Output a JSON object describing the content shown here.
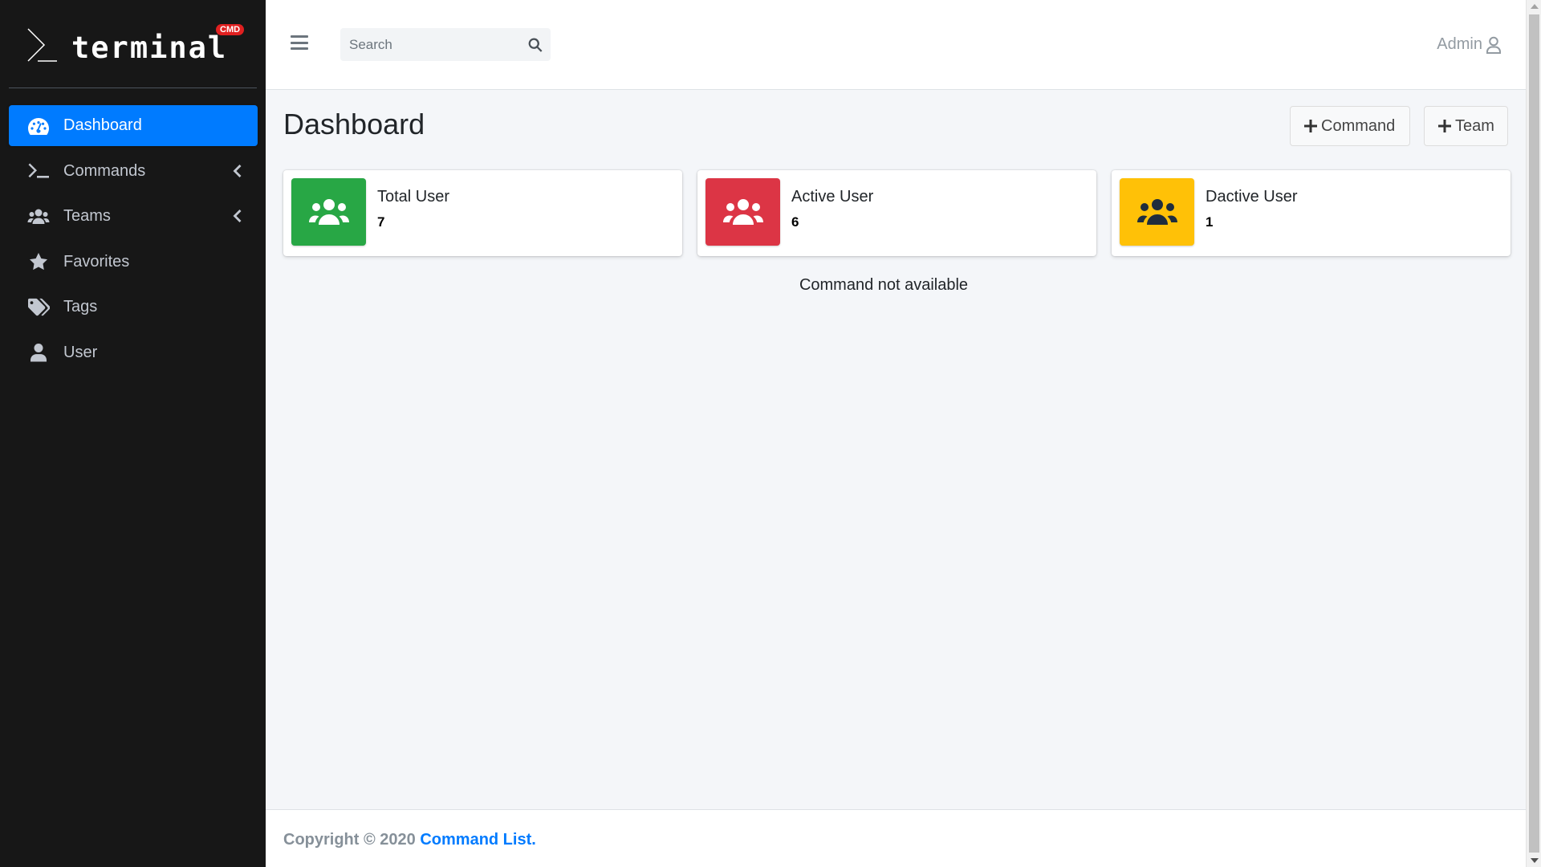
{
  "brand": {
    "name": "terminal",
    "badge": "CMD"
  },
  "sidebar": {
    "items": [
      {
        "label": "Dashboard",
        "icon": "tachometer-icon",
        "active": true
      },
      {
        "label": "Commands",
        "icon": "terminal-icon",
        "has_submenu": true
      },
      {
        "label": "Teams",
        "icon": "users-icon",
        "has_submenu": true
      },
      {
        "label": "Favorites",
        "icon": "star-icon"
      },
      {
        "label": "Tags",
        "icon": "tags-icon"
      },
      {
        "label": "User",
        "icon": "user-icon"
      }
    ]
  },
  "header": {
    "search_placeholder": "Search",
    "user_label": "Admin"
  },
  "main": {
    "title": "Dashboard",
    "add_command_label": "Command",
    "add_team_label": "Team",
    "stats": [
      {
        "label": "Total User",
        "value": "7",
        "color": "#28a745",
        "icon_color": "#ffffff"
      },
      {
        "label": "Active User",
        "value": "6",
        "color": "#dc3545",
        "icon_color": "#ffffff"
      },
      {
        "label": "Dactive User",
        "value": "1",
        "color": "#ffc107",
        "icon_color": "#1f2d3d"
      }
    ],
    "empty_message": "Command not available"
  },
  "footer": {
    "prefix": "Copyright © 2020 ",
    "link": "Command List",
    "suffix": "."
  },
  "colors": {
    "sidebar_bg": "#171717",
    "accent": "#007bff",
    "content_bg": "#f4f6f9"
  }
}
